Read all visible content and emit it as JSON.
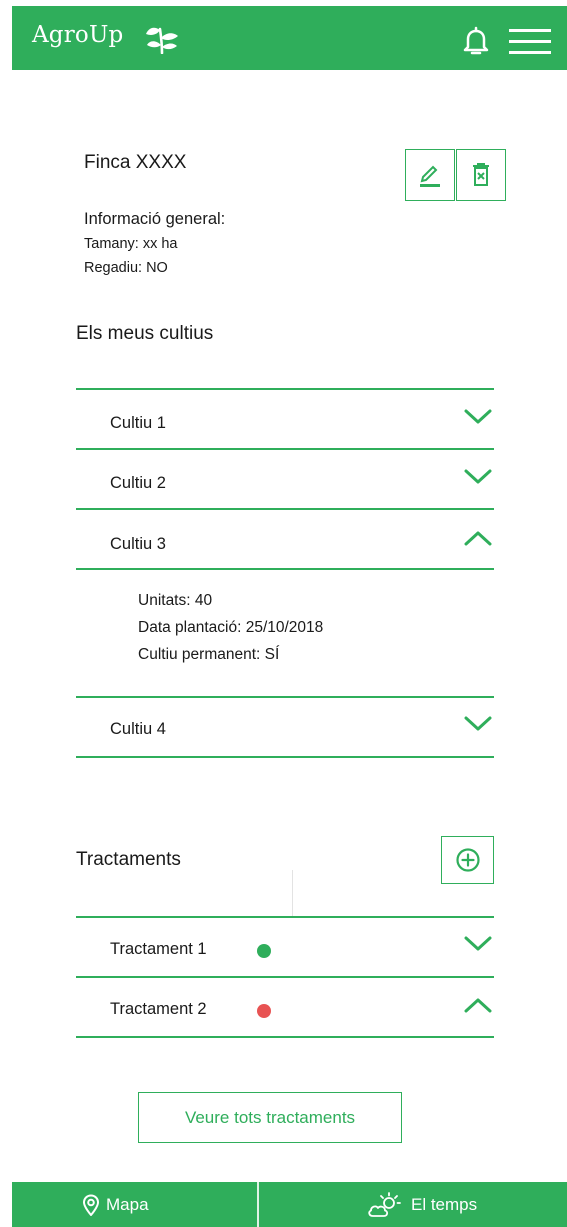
{
  "header": {
    "app_name": "AgroUp",
    "icons": [
      "leaf-icon",
      "bell-icon",
      "menu-icon"
    ]
  },
  "farm": {
    "title": "Finca XXXX",
    "info_heading": "Informació general:",
    "size": "Tamany:  xx ha",
    "irrigation": "Regadiu: NO",
    "actions": [
      "edit-icon",
      "delete-icon"
    ]
  },
  "crops": {
    "title": "Els meus cultius",
    "items": [
      {
        "label": "Cultiu 1",
        "expanded": false
      },
      {
        "label": "Cultiu 2",
        "expanded": false
      },
      {
        "label": "Cultiu 3",
        "expanded": true,
        "details": [
          "Unitats: 40",
          "Data plantació: 25/10/2018",
          "Cultiu permanent: SÍ"
        ]
      },
      {
        "label": "Cultiu 4",
        "expanded": false
      }
    ]
  },
  "treatments": {
    "title": "Tractaments",
    "items": [
      {
        "label": "Tractament 1",
        "status_color": "#2fae5b",
        "expanded": false
      },
      {
        "label": "Tractament 2",
        "status_color": "#e85353",
        "expanded": true
      }
    ],
    "view_all_label": "Veure tots tractaments"
  },
  "bottom_nav": {
    "map_label": "Mapa",
    "weather_label": "El temps"
  },
  "colors": {
    "accent": "#2fae5b",
    "status_ok": "#2fae5b",
    "status_alert": "#e85353"
  }
}
